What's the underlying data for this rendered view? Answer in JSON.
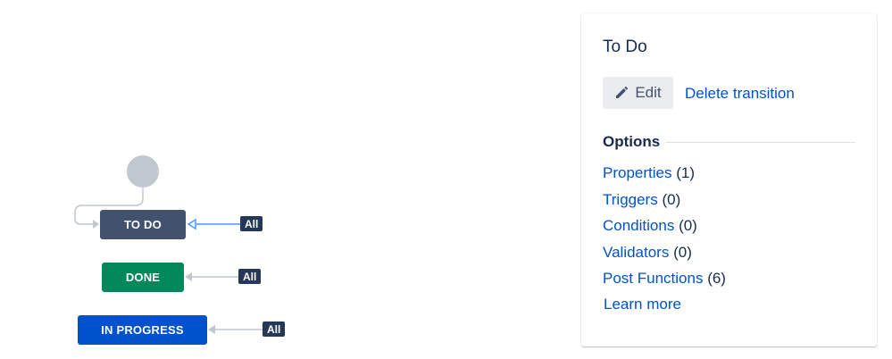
{
  "workflow": {
    "statuses": [
      {
        "label": "TO DO",
        "color": "#42526e"
      },
      {
        "label": "DONE",
        "color": "#00875a"
      },
      {
        "label": "IN PROGRESS",
        "color": "#0052cc"
      }
    ],
    "transitions": [
      {
        "label": "All",
        "target": "TO DO",
        "selected": true
      },
      {
        "label": "All",
        "target": "DONE",
        "selected": false
      },
      {
        "label": "All",
        "target": "IN PROGRESS",
        "selected": false
      }
    ],
    "colors": {
      "selected_connector": "#4c9aff",
      "connector": "#c1c7d0",
      "initial_node": "#c1c7d0"
    }
  },
  "panel": {
    "title": "To Do",
    "edit_label": "Edit",
    "edit_icon": "pencil-icon",
    "delete_label": "Delete transition",
    "options_heading": "Options",
    "options": [
      {
        "label": "Properties",
        "count": "(1)"
      },
      {
        "label": "Triggers",
        "count": "(0)"
      },
      {
        "label": "Conditions",
        "count": "(0)"
      },
      {
        "label": "Validators",
        "count": "(0)"
      },
      {
        "label": "Post Functions",
        "count": "(6)"
      }
    ],
    "learn_more": "Learn more",
    "link_color": "#0052cc"
  }
}
